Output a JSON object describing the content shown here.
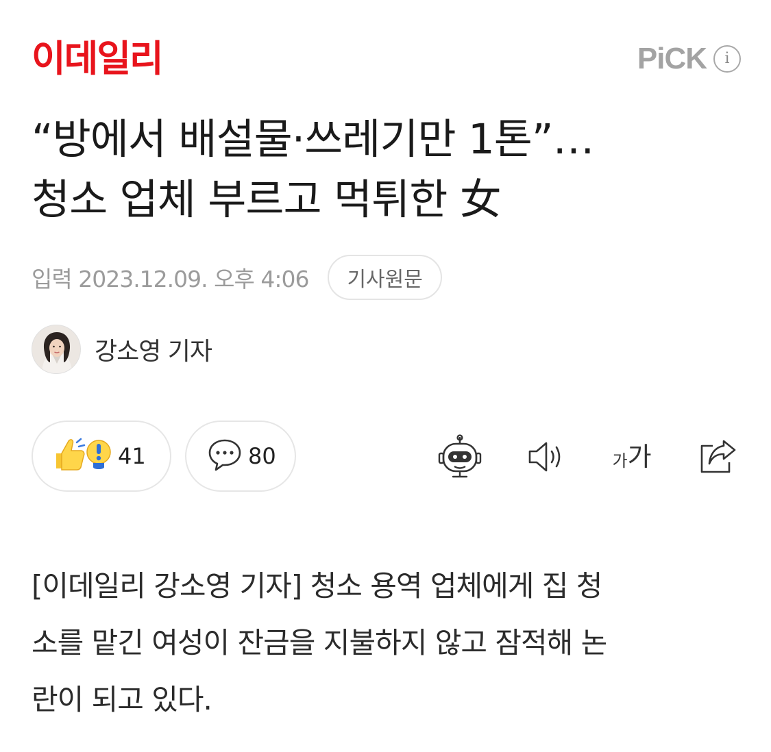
{
  "header": {
    "logo_text": "이데일리",
    "brand_color": "#e8141c",
    "pick_label": "PiCK",
    "info_icon": "info-icon"
  },
  "article": {
    "title_lines": [
      "“방에서 배설물·쓰레기만 1톤”…",
      "청소 업체 부르고 먹튀한 女"
    ],
    "date": "입력 2023.12.09. 오후 4:06",
    "source_button": "기사원문",
    "author": "강소영 기자",
    "body_lines": [
      "[이데일리 강소영 기자] 청소 용역 업체에게 집 청",
      "소를 맡긴 여성이 잔금을 지불하지 않고 잠적해 논",
      "란이 되고 있다."
    ]
  },
  "actions": {
    "reaction_count": "41",
    "comment_count": "80",
    "font_size_label_small": "가",
    "font_size_label_large": "가",
    "icons": [
      "reaction-icon",
      "comment-icon",
      "ai-bot-icon",
      "speaker-icon",
      "font-size-icon",
      "share-icon"
    ]
  }
}
